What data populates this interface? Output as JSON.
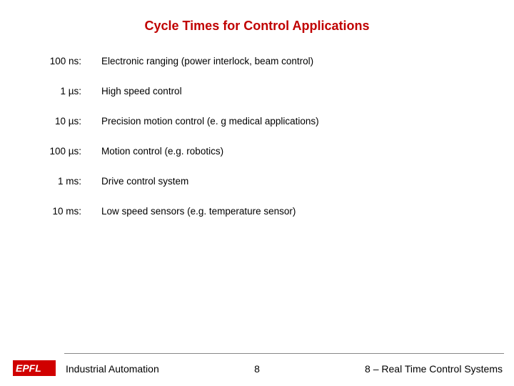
{
  "title": "Cycle Times for Control Applications",
  "rows": [
    {
      "time": "100 ns:",
      "desc": "Electronic ranging (power interlock, beam control)"
    },
    {
      "time": "1 µs:",
      "desc": "High speed control"
    },
    {
      "time": "10 µs:",
      "desc": "Precision motion control (e. g medical applications)"
    },
    {
      "time": "100 µs:",
      "desc": "Motion control (e.g. robotics)"
    },
    {
      "time": "1 ms:",
      "desc": "Drive control system"
    },
    {
      "time": "10 ms:",
      "desc": "Low speed sensors (e.g. temperature sensor)"
    }
  ],
  "footer": {
    "left": "Industrial Automation",
    "center": "8",
    "right": "8 – Real Time Control Systems"
  }
}
